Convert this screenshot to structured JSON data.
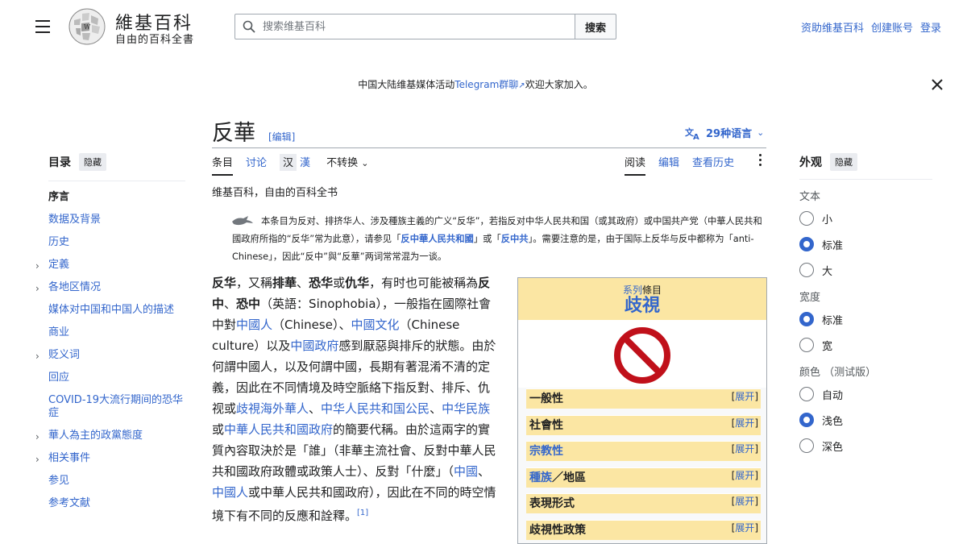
{
  "header": {
    "logo_title": "維基百科",
    "logo_tagline": "自由的百科全書",
    "search_placeholder": "搜索维基百科",
    "search_button": "搜索",
    "user_links": [
      "资助维基百科",
      "创建账号",
      "登录"
    ]
  },
  "notice": {
    "prefix": "中国大陆维基媒体活动",
    "link": "Telegram群聊",
    "suffix": "欢迎大家加入。"
  },
  "toc": {
    "title": "目录",
    "hide": "隐藏",
    "items": [
      {
        "label": "序言",
        "expandable": false
      },
      {
        "label": "数据及背景",
        "expandable": false
      },
      {
        "label": "历史",
        "expandable": false
      },
      {
        "label": "定義",
        "expandable": true
      },
      {
        "label": "各地区情况",
        "expandable": true
      },
      {
        "label": "媒体对中国和中国人的描述",
        "expandable": false
      },
      {
        "label": "商业",
        "expandable": false
      },
      {
        "label": "贬义词",
        "expandable": true
      },
      {
        "label": "回应",
        "expandable": false
      },
      {
        "label": "COVID-19大流行期间的恐华症",
        "expandable": false
      },
      {
        "label": "華人為主的政黨態度",
        "expandable": true
      },
      {
        "label": "相关事件",
        "expandable": true
      },
      {
        "label": "参见",
        "expandable": false
      },
      {
        "label": "参考文献",
        "expandable": false
      }
    ]
  },
  "article": {
    "title": "反華",
    "edit": "[编辑]",
    "languages": "29种语言",
    "tabs_left": {
      "article": "条目",
      "talk": "讨论",
      "variant_a": "汉",
      "variant_b": "漢",
      "no_convert": "不转换"
    },
    "tabs_right": {
      "read": "阅读",
      "edit": "编辑",
      "history": "查看历史"
    },
    "site_sub": "维基百科，自由的百科全书",
    "hatnote": {
      "text1": "本条目为反对、排挤华人、涉及種族主義的广义“反华”，若指反对中华人民共和国（或其政府）或中国共产党（中華人民共和國政府所指的“反华”常为此意），请参见「",
      "link1": "反中華人民共和國",
      "text2": "」或「",
      "link2": "反中共",
      "text3": "」。需要注意的是，由于国际上反华与反中都称为「anti-Chinese」，因此“反中”與“反華”两词常常混为一谈。"
    },
    "body": {
      "p1": "反华",
      "p2": "，又稱",
      "p3": "排華",
      "p4": "、",
      "p5": "恐华",
      "p6": "或",
      "p7": "仇华",
      "p8": "，有时也可能被稱為",
      "p9": "反中",
      "p10": "、",
      "p11": "恐中",
      "p12": "（英語：Sinophobia），一般指在國際社會中對",
      "l1": "中國人",
      "p13": "（Chinese）、",
      "l2": "中國文化",
      "p14": "（Chinese culture）以及",
      "l3": "中國政府",
      "p15": "感到厭惡與排斥的狀態。由於何謂中國人，以及何謂中國，長期有著混淆不清的定義，因此在不同情境及時空脈絡下指反對、排斥、仇视或",
      "l4": "歧視海外華人",
      "p16": "、",
      "l5": "中华人民共和国公民",
      "p17": "、",
      "l6": "中华民族",
      "p18": "或",
      "l7": "中華人民共和國政府",
      "p19": "的簡要代稱。由於這兩字的實質內容取決於是「誰」（非華主流社會、反對中華人民共和國政府政體或政策人士）、反對「什麼」（",
      "l8": "中國",
      "p20": "、",
      "l9": "中國人",
      "p21": "或中華人民共和國政府），因此在不同的時空情境下有不同的反應和詮釋。",
      "ref": "[1]"
    }
  },
  "infobox": {
    "series_link": "系列",
    "series_text": "條目",
    "main": "歧視",
    "expand_label": "展开",
    "rows": [
      {
        "label": "一般性",
        "link": false
      },
      {
        "label": "社會性",
        "link": false
      },
      {
        "label": "宗教性",
        "link": true
      },
      {
        "label": "種族",
        "label2": "／地區",
        "link": true
      },
      {
        "label": "表現形式",
        "link": false
      },
      {
        "label": "歧視性政策",
        "link": false
      }
    ]
  },
  "appearance": {
    "title": "外观",
    "hide": "隐藏",
    "text_label": "文本",
    "text_options": [
      {
        "label": "小",
        "on": false
      },
      {
        "label": "标准",
        "on": true
      },
      {
        "label": "大",
        "on": false
      }
    ],
    "width_label": "宽度",
    "width_options": [
      {
        "label": "标准",
        "on": true
      },
      {
        "label": "宽",
        "on": false
      }
    ],
    "color_label": "颜色 （测试版）",
    "color_options": [
      {
        "label": "自动",
        "on": false
      },
      {
        "label": "浅色",
        "on": true
      },
      {
        "label": "深色",
        "on": false
      }
    ]
  },
  "colors": {
    "link": "#3366cc",
    "infobox_header": "#fbe6a3",
    "no_symbol": "#c0101a"
  }
}
